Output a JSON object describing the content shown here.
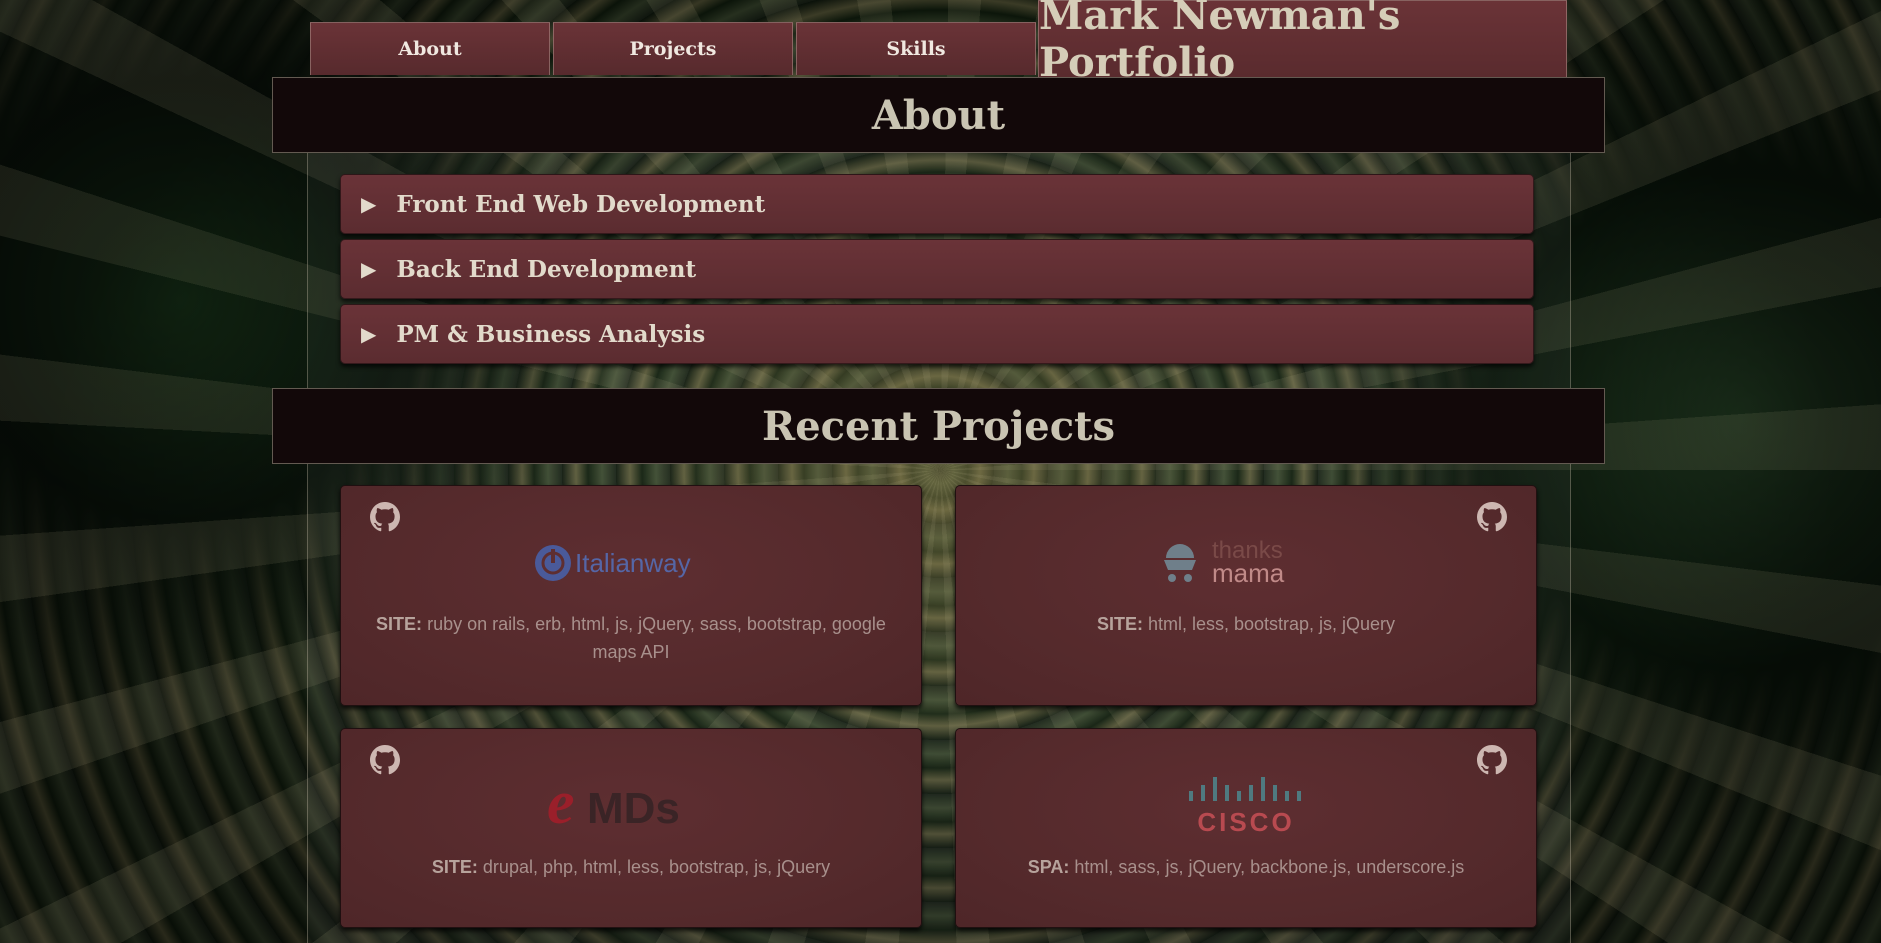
{
  "nav": {
    "tabs": [
      "About",
      "Projects",
      "Skills"
    ],
    "brand": "Mark Newman's Portfolio"
  },
  "about": {
    "title": "About",
    "items": [
      "Front End Web Development",
      "Back End Development",
      "PM & Business Analysis"
    ]
  },
  "projects": {
    "title": "Recent Projects",
    "cards": [
      {
        "logo": "Italianway",
        "kind": "SITE:",
        "tech": "ruby on rails, erb, html, js, jQuery, sass, bootstrap, google maps API"
      },
      {
        "logo_line1": "thanks",
        "logo_line2": "mama",
        "kind": "SITE:",
        "tech": "html, less, bootstrap, js, jQuery"
      },
      {
        "logo_e": "e",
        "logo_rest": "MDs",
        "kind": "SITE:",
        "tech": "drupal, php, html, less, bootstrap, js, jQuery"
      },
      {
        "logo": "CISCO",
        "kind": "SPA:",
        "tech": "html, sass, js, jQuery, backbone.js, underscore.js"
      }
    ]
  },
  "colors": {
    "panel": "#5a2b2e",
    "section_bar": "#120809",
    "heading_text": "#c9c4b2"
  },
  "icons": [
    "github-icon",
    "triangle-right-icon"
  ]
}
